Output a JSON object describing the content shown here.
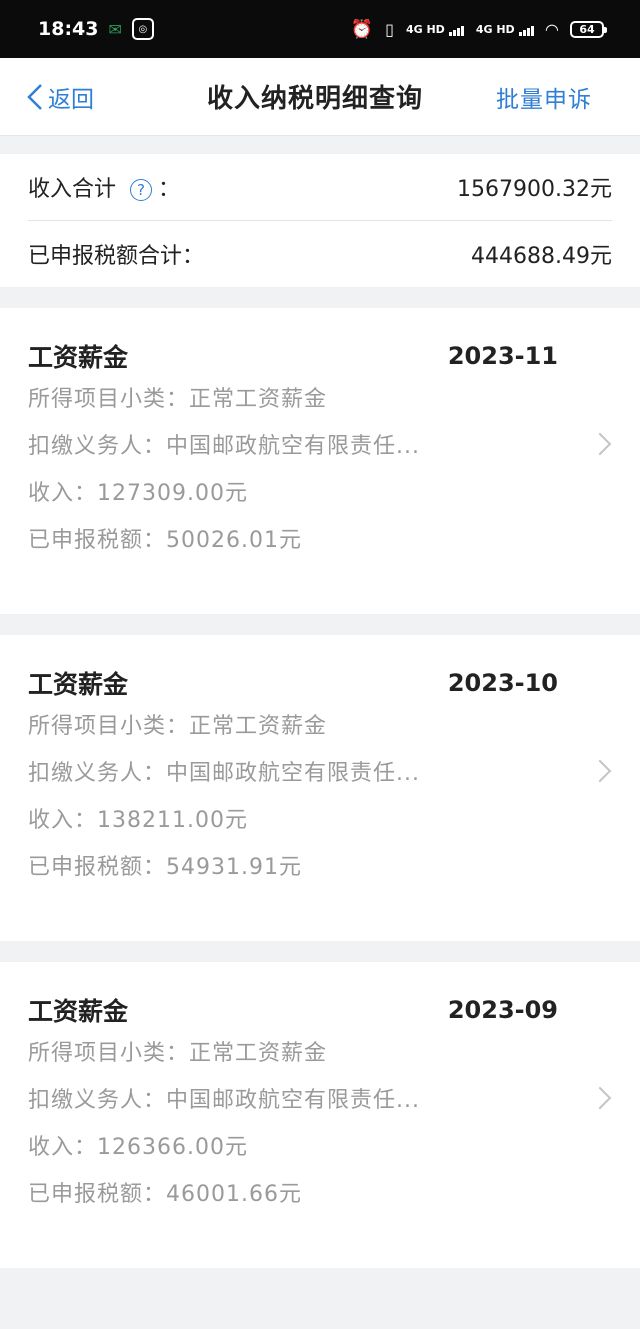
{
  "status": {
    "time": "18:43",
    "net1": "4G HD",
    "net2": "4G HD",
    "battery": "64"
  },
  "nav": {
    "back_label": "返回",
    "title": "收入纳税明细查询",
    "action_label": "批量申诉"
  },
  "summary": {
    "income_label": "收入合计",
    "colon": "：",
    "income_value": "1567900.32元",
    "tax_label": "已申报税额合计：",
    "tax_value": "444688.49元"
  },
  "records": [
    {
      "type": "工资薪金",
      "date": "2023-11",
      "subcategory": "所得项目小类：正常工资薪金",
      "payer": "扣缴义务人：中国邮政航空有限责任...",
      "income": "收入：127309.00元",
      "tax": "已申报税额：50026.01元"
    },
    {
      "type": "工资薪金",
      "date": "2023-10",
      "subcategory": "所得项目小类：正常工资薪金",
      "payer": "扣缴义务人：中国邮政航空有限责任...",
      "income": "收入：138211.00元",
      "tax": "已申报税额：54931.91元"
    },
    {
      "type": "工资薪金",
      "date": "2023-09",
      "subcategory": "所得项目小类：正常工资薪金",
      "payer": "扣缴义务人：中国邮政航空有限责任...",
      "income": "收入：126366.00元",
      "tax": "已申报税额：46001.66元"
    }
  ],
  "colors": {
    "accent": "#2f7fd6",
    "muted_text": "#9a9a9a",
    "page_bg": "#f1f2f4"
  }
}
